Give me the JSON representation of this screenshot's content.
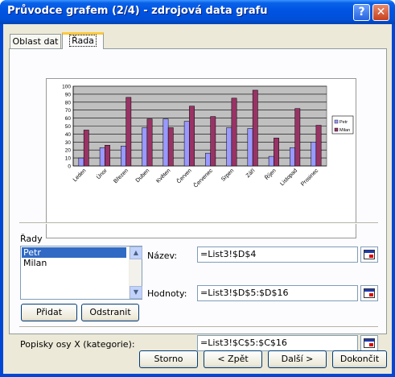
{
  "window": {
    "title": "Průvodce grafem (2/4) - zdrojová data grafu",
    "help_label": "?",
    "close_label": "✕"
  },
  "tabs": [
    {
      "label": "Oblast dat",
      "active": false
    },
    {
      "label": "Řada",
      "active": true
    }
  ],
  "series_section": {
    "label": "Řady",
    "items": [
      {
        "label": "Petr",
        "selected": true
      },
      {
        "label": "Milan",
        "selected": false
      }
    ],
    "add_button": "Přidat",
    "remove_button": "Odstranit"
  },
  "name_field": {
    "label": "Název:",
    "value": "=List3!$D$4"
  },
  "values_field": {
    "label": "Hodnoty:",
    "value": "=List3!$D$5:$D$16"
  },
  "category_field": {
    "label": "Popisky osy X (kategorie):",
    "value": "=List3!$C$5:$C$16"
  },
  "footer": {
    "cancel": "Storno",
    "back": "< Zpět",
    "next": "Další >",
    "finish": "Dokončit"
  },
  "chart_data": {
    "type": "bar",
    "categories": [
      "Leden",
      "Únor",
      "Březen",
      "Duben",
      "Květen",
      "Červen",
      "Červenec",
      "Srpen",
      "Září",
      "Říjen",
      "Listopad",
      "Prosinec"
    ],
    "series": [
      {
        "name": "Petr",
        "color": "#9999ff",
        "values": [
          10,
          23,
          25,
          48,
          59,
          56,
          16,
          48,
          47,
          12,
          23,
          30
        ]
      },
      {
        "name": "Milan",
        "color": "#993366",
        "values": [
          45,
          26,
          86,
          59,
          48,
          75,
          62,
          85,
          95,
          35,
          72,
          51
        ]
      }
    ],
    "ylim": [
      0,
      100
    ],
    "yticks": [
      "0",
      "10",
      "20",
      "30",
      "40",
      "50",
      "60",
      "70",
      "80",
      "90",
      "100"
    ],
    "plot_background": "#c0c0c0",
    "grid": true,
    "legend": "right"
  }
}
